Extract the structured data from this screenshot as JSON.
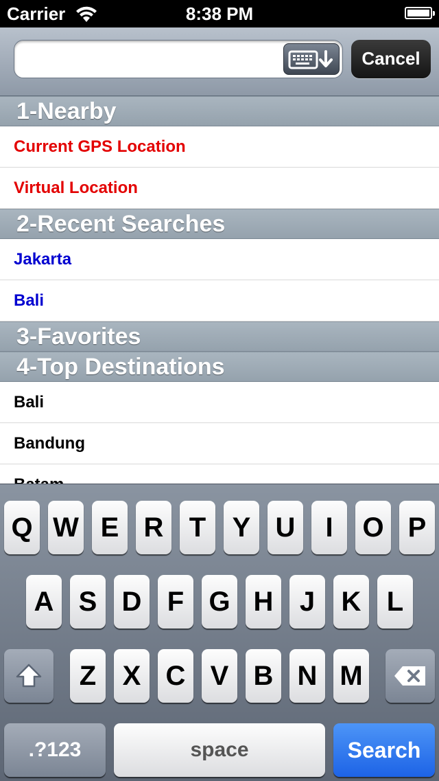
{
  "status_bar": {
    "carrier": "Carrier",
    "time": "8:38 PM"
  },
  "search": {
    "value": "",
    "placeholder": "",
    "cancel_label": "Cancel"
  },
  "sections": [
    {
      "header": "1-Nearby",
      "rows": [
        {
          "label": "Current GPS Location",
          "color": "#e30000"
        },
        {
          "label": "Virtual Location",
          "color": "#e30000"
        }
      ]
    },
    {
      "header": "2-Recent Searches",
      "rows": [
        {
          "label": "Jakarta",
          "color": "#0000d0"
        },
        {
          "label": "Bali",
          "color": "#0000d0"
        }
      ]
    },
    {
      "header": "3-Favorites",
      "rows": []
    },
    {
      "header": "4-Top Destinations",
      "rows": [
        {
          "label": "Bali",
          "color": "#000000"
        },
        {
          "label": "Bandung",
          "color": "#000000"
        },
        {
          "label": "Batam",
          "color": "#000000"
        }
      ]
    }
  ],
  "keyboard": {
    "row1": [
      "Q",
      "W",
      "E",
      "R",
      "T",
      "Y",
      "U",
      "I",
      "O",
      "P"
    ],
    "row2": [
      "A",
      "S",
      "D",
      "F",
      "G",
      "H",
      "J",
      "K",
      "L"
    ],
    "row3": [
      "Z",
      "X",
      "C",
      "V",
      "B",
      "N",
      "M"
    ],
    "numbers_label": ".?123",
    "space_label": "space",
    "search_label": "Search"
  },
  "colors": {
    "search_key": "#1d63e6"
  }
}
